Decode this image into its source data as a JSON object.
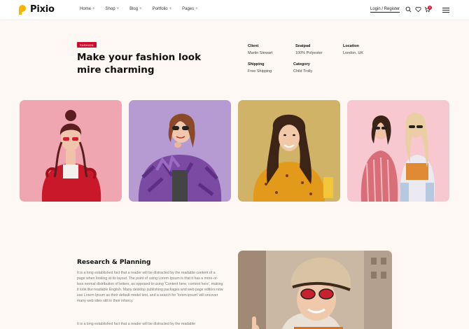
{
  "brand": {
    "name": "Pixio",
    "accent": "#f7b500"
  },
  "nav": [
    {
      "label": "Home"
    },
    {
      "label": "Shop"
    },
    {
      "label": "Blog"
    },
    {
      "label": "Portfolio"
    },
    {
      "label": "Pages"
    }
  ],
  "nav_plus": "+",
  "header": {
    "login_label": "Login / Register",
    "cart_count": "0",
    "icons": [
      "search-icon",
      "heart-icon",
      "cart-icon",
      "menu-icon"
    ]
  },
  "project": {
    "tag": "FASHION",
    "title": "Make your fashion look mire charming",
    "meta": {
      "client": {
        "label": "Client",
        "value": "Martin Stewart"
      },
      "seatpad": {
        "label": "Seatpad",
        "value": "100% Polyester"
      },
      "location": {
        "label": "Location",
        "value": "London, UK"
      },
      "shipping": {
        "label": "Shipping",
        "value": "Free Shipping"
      },
      "category": {
        "label": "Category",
        "value": "Child Trolly"
      }
    },
    "tag_color": "#c8102e"
  },
  "research": {
    "title": "Research & Planning",
    "paragraph1": "It is a long established fact that a reader will be distracted by the readable content of a page when looking at its layout. The point of using Lorem Ipsum is that it has a more-or-less normal distribution of letters, as opposed to using 'Content here, content here', making it look like readable English. Many desktop publishing packages and web page editors now use Lorem Ipsum as their default model text, and a search for 'lorem ipsum' will uncover many web sites still in their infancy.",
    "paragraph2": "It is a long established fact that a reader will be distracted by the readable"
  }
}
